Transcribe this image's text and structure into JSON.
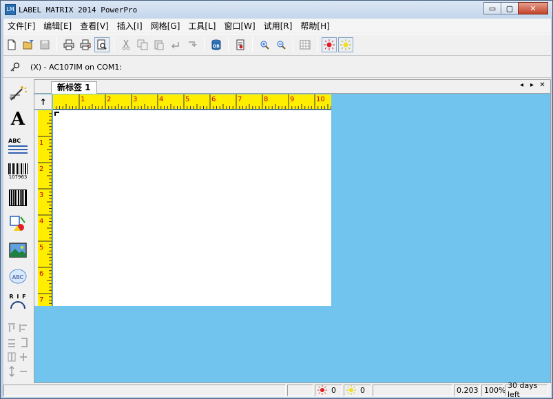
{
  "app": {
    "title": "LABEL MATRIX 2014 PowerPro",
    "icon_letters": "LM"
  },
  "window_controls": {
    "minimize": "▭",
    "maximize": "▢",
    "close": "✕"
  },
  "menu": [
    {
      "label": "文件[F]"
    },
    {
      "label": "编辑[E]"
    },
    {
      "label": "查看[V]"
    },
    {
      "label": "插入[I]"
    },
    {
      "label": "网格[G]"
    },
    {
      "label": "工具[L]"
    },
    {
      "label": "窗口[W]"
    },
    {
      "label": "试用[R]"
    },
    {
      "label": "帮助[H]"
    }
  ],
  "toolbar": {
    "db_label": "DB"
  },
  "port": {
    "status": "(X) - AC107IM on COM1:"
  },
  "document": {
    "tab_label": "新标签 1",
    "nav_prev": "◂",
    "nav_next": "▸",
    "nav_close": "✕",
    "corner_arrow": "↑",
    "ruler_h_numbers": [
      "1",
      "2",
      "3",
      "4",
      "5",
      "6",
      "7",
      "8",
      "9",
      "10"
    ],
    "ruler_v_numbers": [
      "1",
      "2",
      "3",
      "4",
      "5",
      "6",
      "7"
    ]
  },
  "left_tools": {
    "text_tool_glyph": "A",
    "paragraph_label": "ABC",
    "barcode_number": "107963",
    "rfid_letters": "R I F"
  },
  "status": {
    "red_count": "0",
    "yellow_count": "0",
    "scale": "0.203",
    "zoom": "100%",
    "trial": "30 days left"
  },
  "colors": {
    "ruler": "#ffee00",
    "workspace": "#70c4ee",
    "canvas": "#ffffff"
  }
}
